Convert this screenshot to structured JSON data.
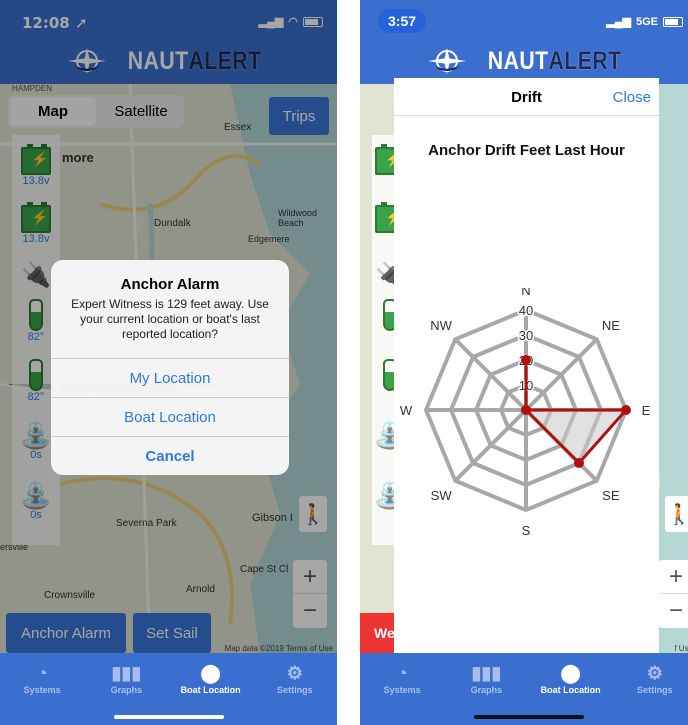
{
  "screen1": {
    "status": {
      "time": "12:08 ➚"
    },
    "logo": {
      "part1": "NAUT",
      "part2": "ALERT"
    },
    "map_toggle": {
      "map": "Map",
      "satellite": "Satellite"
    },
    "trips_label": "Trips",
    "map_labels": [
      "more",
      "Essex",
      "Dundalk",
      "Edgemere",
      "Wildwood Beach",
      "Severna Park",
      "Gibson I",
      "Arnold",
      "Crownsville",
      "Cape St Cl",
      "ersville",
      "HAMPDEN"
    ],
    "sidebar": [
      {
        "icon": "battery-icon",
        "value": "13.8v"
      },
      {
        "icon": "battery-icon",
        "value": "13.8v"
      },
      {
        "icon": "shore-power-icon",
        "value": ""
      },
      {
        "icon": "thermometer-icon",
        "value": "82°"
      },
      {
        "icon": "thermometer-icon",
        "value": "82°"
      },
      {
        "icon": "bilge-pump-icon",
        "value": "0s"
      },
      {
        "icon": "bilge-pump-icon",
        "value": "0s"
      }
    ],
    "alert": {
      "title": "Anchor Alarm",
      "message": "Expert Witness is 129 feet away. Use your current location or boat's last reported location?",
      "buttons": [
        "My Location",
        "Boat Location",
        "Cancel"
      ]
    },
    "bottom_buttons": {
      "anchor_alarm": "Anchor Alarm",
      "set_sail": "Set Sail"
    },
    "zoom": {
      "plus": "+",
      "minus": "−"
    },
    "map_footer": "Map data ©2019   Terms of Use"
  },
  "screen2": {
    "status": {
      "time": "3:57",
      "network": "5GE"
    },
    "sheet": {
      "title": "Drift",
      "close": "Close"
    },
    "redbtn": "We",
    "map_footer": "f Use"
  },
  "tabs": [
    {
      "icon": "speedometer-icon",
      "label": "Systems"
    },
    {
      "icon": "bar-chart-icon",
      "label": "Graphs"
    },
    {
      "icon": "boat-location-icon",
      "label": "Boat Location"
    },
    {
      "icon": "gear-icon",
      "label": "Settings"
    }
  ],
  "active_tab": "Boat Location",
  "colors": {
    "brand_blue": "#3a6fcf",
    "button_blue": "#3a75d8",
    "link_blue": "#2d7be0",
    "drift_red": "#b01010",
    "grid_gray": "#a8a8a8"
  },
  "chart_data": {
    "type": "radar",
    "title": "Anchor Drift Feet Last Hour",
    "categories": [
      "N",
      "NE",
      "E",
      "SE",
      "S",
      "SW",
      "W",
      "NW"
    ],
    "tick_labels": [
      "10",
      "20",
      "30",
      "40"
    ],
    "rmax": 40,
    "series": [
      {
        "values": [
          20,
          0,
          40,
          30,
          0,
          0,
          0,
          0
        ]
      }
    ]
  }
}
